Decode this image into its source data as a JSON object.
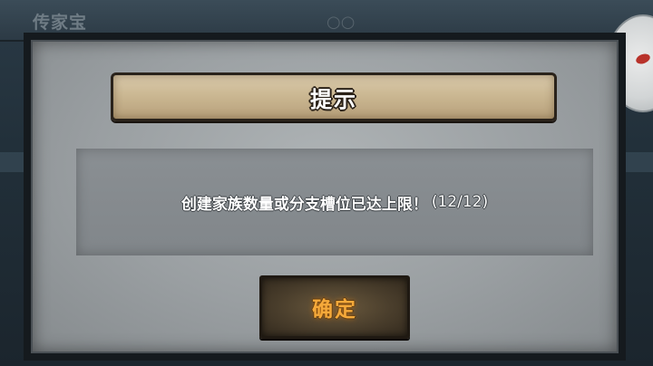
{
  "background": {
    "screen_title": "传家宝",
    "glasses_icon": "glasses-icon"
  },
  "dialog": {
    "title": "提示",
    "message": "创建家族数量或分支槽位已达上限！",
    "count": "(12/12)",
    "confirm_label": "确定"
  },
  "colors": {
    "banner": "#cbb893",
    "panel": "#9a9fa2",
    "button": "#4a3e2c",
    "button_text": "#f5a93a"
  }
}
